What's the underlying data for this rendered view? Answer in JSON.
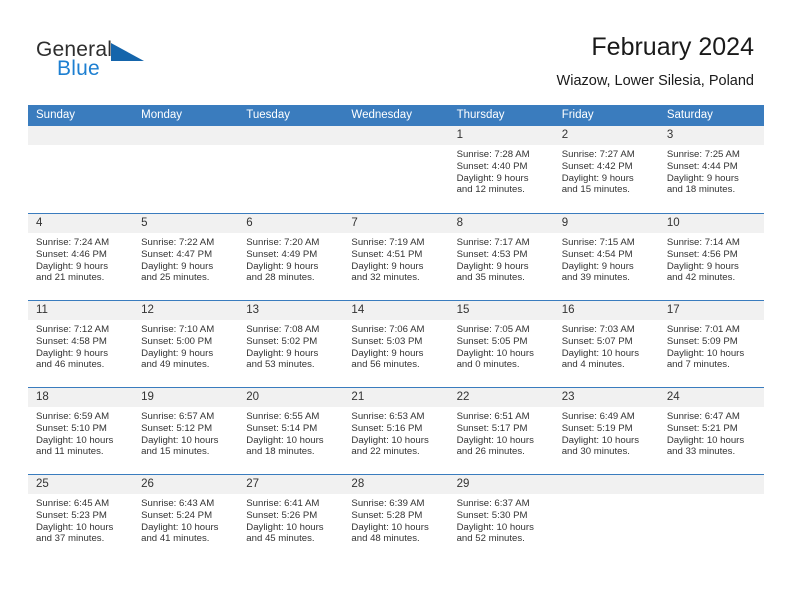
{
  "brand": {
    "word1": "General",
    "word2": "Blue",
    "logo_icon": "triangle-logo-icon",
    "accent_color": "#1565ab",
    "blue_text_color": "#1d7fd1"
  },
  "header": {
    "title": "February 2024",
    "subtitle": "Wiazow, Lower Silesia, Poland"
  },
  "theme": {
    "header_row_bg": "#3a7cbe",
    "day_band_bg": "#f1f1f1",
    "row_separator": "#3a7cbe",
    "text_color": "#333333"
  },
  "weekdays": [
    "Sunday",
    "Monday",
    "Tuesday",
    "Wednesday",
    "Thursday",
    "Friday",
    "Saturday"
  ],
  "weeks": [
    [
      {
        "day": "",
        "empty": true
      },
      {
        "day": "",
        "empty": true
      },
      {
        "day": "",
        "empty": true
      },
      {
        "day": "",
        "empty": true
      },
      {
        "day": "1",
        "sunrise": "Sunrise: 7:28 AM",
        "sunset": "Sunset: 4:40 PM",
        "daylight1": "Daylight: 9 hours",
        "daylight2": "and 12 minutes."
      },
      {
        "day": "2",
        "sunrise": "Sunrise: 7:27 AM",
        "sunset": "Sunset: 4:42 PM",
        "daylight1": "Daylight: 9 hours",
        "daylight2": "and 15 minutes."
      },
      {
        "day": "3",
        "sunrise": "Sunrise: 7:25 AM",
        "sunset": "Sunset: 4:44 PM",
        "daylight1": "Daylight: 9 hours",
        "daylight2": "and 18 minutes."
      }
    ],
    [
      {
        "day": "4",
        "sunrise": "Sunrise: 7:24 AM",
        "sunset": "Sunset: 4:46 PM",
        "daylight1": "Daylight: 9 hours",
        "daylight2": "and 21 minutes."
      },
      {
        "day": "5",
        "sunrise": "Sunrise: 7:22 AM",
        "sunset": "Sunset: 4:47 PM",
        "daylight1": "Daylight: 9 hours",
        "daylight2": "and 25 minutes."
      },
      {
        "day": "6",
        "sunrise": "Sunrise: 7:20 AM",
        "sunset": "Sunset: 4:49 PM",
        "daylight1": "Daylight: 9 hours",
        "daylight2": "and 28 minutes."
      },
      {
        "day": "7",
        "sunrise": "Sunrise: 7:19 AM",
        "sunset": "Sunset: 4:51 PM",
        "daylight1": "Daylight: 9 hours",
        "daylight2": "and 32 minutes."
      },
      {
        "day": "8",
        "sunrise": "Sunrise: 7:17 AM",
        "sunset": "Sunset: 4:53 PM",
        "daylight1": "Daylight: 9 hours",
        "daylight2": "and 35 minutes."
      },
      {
        "day": "9",
        "sunrise": "Sunrise: 7:15 AM",
        "sunset": "Sunset: 4:54 PM",
        "daylight1": "Daylight: 9 hours",
        "daylight2": "and 39 minutes."
      },
      {
        "day": "10",
        "sunrise": "Sunrise: 7:14 AM",
        "sunset": "Sunset: 4:56 PM",
        "daylight1": "Daylight: 9 hours",
        "daylight2": "and 42 minutes."
      }
    ],
    [
      {
        "day": "11",
        "sunrise": "Sunrise: 7:12 AM",
        "sunset": "Sunset: 4:58 PM",
        "daylight1": "Daylight: 9 hours",
        "daylight2": "and 46 minutes."
      },
      {
        "day": "12",
        "sunrise": "Sunrise: 7:10 AM",
        "sunset": "Sunset: 5:00 PM",
        "daylight1": "Daylight: 9 hours",
        "daylight2": "and 49 minutes."
      },
      {
        "day": "13",
        "sunrise": "Sunrise: 7:08 AM",
        "sunset": "Sunset: 5:02 PM",
        "daylight1": "Daylight: 9 hours",
        "daylight2": "and 53 minutes."
      },
      {
        "day": "14",
        "sunrise": "Sunrise: 7:06 AM",
        "sunset": "Sunset: 5:03 PM",
        "daylight1": "Daylight: 9 hours",
        "daylight2": "and 56 minutes."
      },
      {
        "day": "15",
        "sunrise": "Sunrise: 7:05 AM",
        "sunset": "Sunset: 5:05 PM",
        "daylight1": "Daylight: 10 hours",
        "daylight2": "and 0 minutes."
      },
      {
        "day": "16",
        "sunrise": "Sunrise: 7:03 AM",
        "sunset": "Sunset: 5:07 PM",
        "daylight1": "Daylight: 10 hours",
        "daylight2": "and 4 minutes."
      },
      {
        "day": "17",
        "sunrise": "Sunrise: 7:01 AM",
        "sunset": "Sunset: 5:09 PM",
        "daylight1": "Daylight: 10 hours",
        "daylight2": "and 7 minutes."
      }
    ],
    [
      {
        "day": "18",
        "sunrise": "Sunrise: 6:59 AM",
        "sunset": "Sunset: 5:10 PM",
        "daylight1": "Daylight: 10 hours",
        "daylight2": "and 11 minutes."
      },
      {
        "day": "19",
        "sunrise": "Sunrise: 6:57 AM",
        "sunset": "Sunset: 5:12 PM",
        "daylight1": "Daylight: 10 hours",
        "daylight2": "and 15 minutes."
      },
      {
        "day": "20",
        "sunrise": "Sunrise: 6:55 AM",
        "sunset": "Sunset: 5:14 PM",
        "daylight1": "Daylight: 10 hours",
        "daylight2": "and 18 minutes."
      },
      {
        "day": "21",
        "sunrise": "Sunrise: 6:53 AM",
        "sunset": "Sunset: 5:16 PM",
        "daylight1": "Daylight: 10 hours",
        "daylight2": "and 22 minutes."
      },
      {
        "day": "22",
        "sunrise": "Sunrise: 6:51 AM",
        "sunset": "Sunset: 5:17 PM",
        "daylight1": "Daylight: 10 hours",
        "daylight2": "and 26 minutes."
      },
      {
        "day": "23",
        "sunrise": "Sunrise: 6:49 AM",
        "sunset": "Sunset: 5:19 PM",
        "daylight1": "Daylight: 10 hours",
        "daylight2": "and 30 minutes."
      },
      {
        "day": "24",
        "sunrise": "Sunrise: 6:47 AM",
        "sunset": "Sunset: 5:21 PM",
        "daylight1": "Daylight: 10 hours",
        "daylight2": "and 33 minutes."
      }
    ],
    [
      {
        "day": "25",
        "sunrise": "Sunrise: 6:45 AM",
        "sunset": "Sunset: 5:23 PM",
        "daylight1": "Daylight: 10 hours",
        "daylight2": "and 37 minutes."
      },
      {
        "day": "26",
        "sunrise": "Sunrise: 6:43 AM",
        "sunset": "Sunset: 5:24 PM",
        "daylight1": "Daylight: 10 hours",
        "daylight2": "and 41 minutes."
      },
      {
        "day": "27",
        "sunrise": "Sunrise: 6:41 AM",
        "sunset": "Sunset: 5:26 PM",
        "daylight1": "Daylight: 10 hours",
        "daylight2": "and 45 minutes."
      },
      {
        "day": "28",
        "sunrise": "Sunrise: 6:39 AM",
        "sunset": "Sunset: 5:28 PM",
        "daylight1": "Daylight: 10 hours",
        "daylight2": "and 48 minutes."
      },
      {
        "day": "29",
        "sunrise": "Sunrise: 6:37 AM",
        "sunset": "Sunset: 5:30 PM",
        "daylight1": "Daylight: 10 hours",
        "daylight2": "and 52 minutes."
      },
      {
        "day": "",
        "empty": true
      },
      {
        "day": "",
        "empty": true
      }
    ]
  ]
}
